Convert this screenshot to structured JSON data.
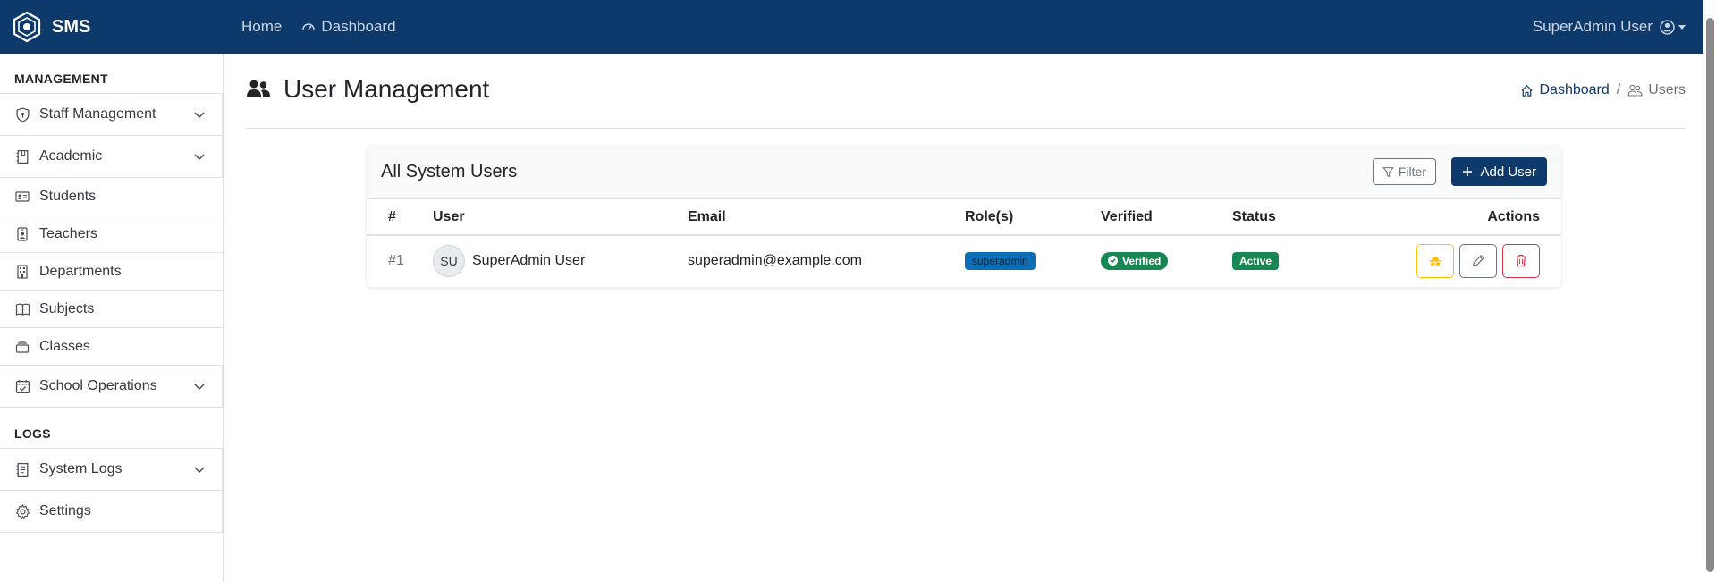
{
  "app": {
    "brand": "SMS"
  },
  "topnav": {
    "home": "Home",
    "dashboard": "Dashboard",
    "user": "SuperAdmin User"
  },
  "sidebar": {
    "management_heading": "MANAGEMENT",
    "logs_heading": "LOGS",
    "items": [
      {
        "label": "Staff Management",
        "icon": "shield-lock-icon",
        "expandable": true
      },
      {
        "label": "Academic",
        "icon": "journal-bookmark-icon",
        "expandable": true
      },
      {
        "label": "Students",
        "icon": "person-vcard-icon",
        "expandable": false
      },
      {
        "label": "Teachers",
        "icon": "person-badge-icon",
        "expandable": false
      },
      {
        "label": "Departments",
        "icon": "building-icon",
        "expandable": false
      },
      {
        "label": "Subjects",
        "icon": "book-icon",
        "expandable": false
      },
      {
        "label": "Classes",
        "icon": "collection-icon",
        "expandable": false
      },
      {
        "label": "School Operations",
        "icon": "calendar-check-icon",
        "expandable": true
      }
    ],
    "log_items": [
      {
        "label": "System Logs",
        "icon": "journal-text-icon",
        "expandable": true
      },
      {
        "label": "Settings",
        "icon": "gear-icon",
        "expandable": false
      }
    ]
  },
  "page": {
    "title": "User Management",
    "breadcrumb": {
      "dashboard": "Dashboard",
      "sep": "/",
      "current": "Users"
    }
  },
  "card": {
    "title": "All System Users",
    "filter_label": "Filter",
    "add_label": "Add User"
  },
  "table": {
    "headers": [
      "#",
      "User",
      "Email",
      "Role(s)",
      "Verified",
      "Status",
      "Actions"
    ],
    "rows": [
      {
        "num": "#1",
        "initials": "SU",
        "name": "SuperAdmin User",
        "email": "superadmin@example.com",
        "role": "superadmin",
        "verified": "Verified",
        "status": "Active"
      }
    ]
  },
  "colors": {
    "navbar": "#0e3a6b",
    "primary": "#0e3a6b",
    "success": "#198754",
    "role_badge": "#0b6fb5",
    "warning": "#ffc107",
    "danger": "#dc3545"
  }
}
